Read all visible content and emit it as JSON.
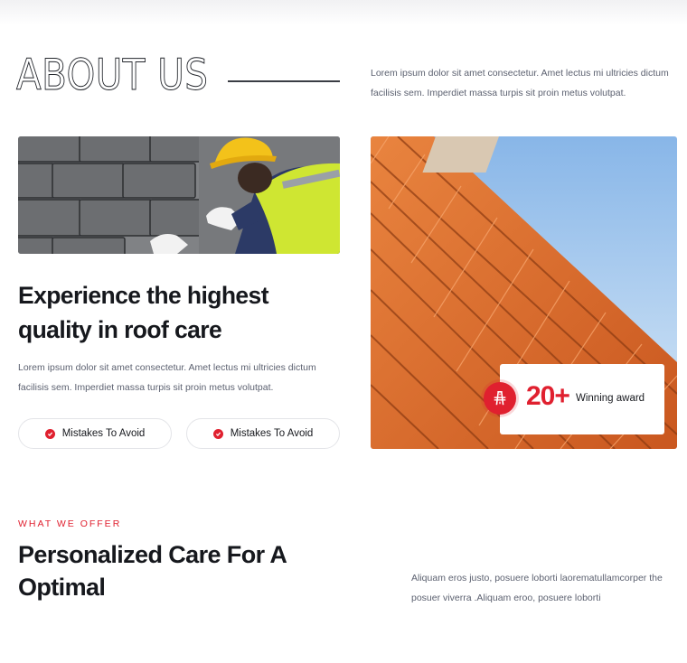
{
  "about": {
    "title": "ABOUT US",
    "description": "Lorem ipsum dolor sit amet consectetur. Amet lectus mi ultricies dictum facilisis sem. Imperdiet massa turpis sit proin metus volutpat."
  },
  "experience": {
    "heading": "Experience the highest quality in roof care",
    "description": "Lorem ipsum dolor sit amet consectetur. Amet lectus mi ultricies dictum facilisis sem. Imperdiet massa turpis sit proin metus volutpat.",
    "pills": [
      "Mistakes To Avoid",
      "Mistakes To Avoid"
    ]
  },
  "award": {
    "number": "20+",
    "label": "Winning award"
  },
  "offer": {
    "eyebrow": "WHAT WE OFFER",
    "heading": "Personalized Care For A Optimal",
    "description": "Aliquam eros justo, posuere loborti laorematullamcorper the posuer viverra .Aliquam eroo, posuere loborti"
  },
  "colors": {
    "accent": "#e0202f",
    "heading": "#16181d",
    "body_text": "#5c6170"
  },
  "icons": {
    "check": "check-circle-icon",
    "award": "road-sign-icon"
  }
}
